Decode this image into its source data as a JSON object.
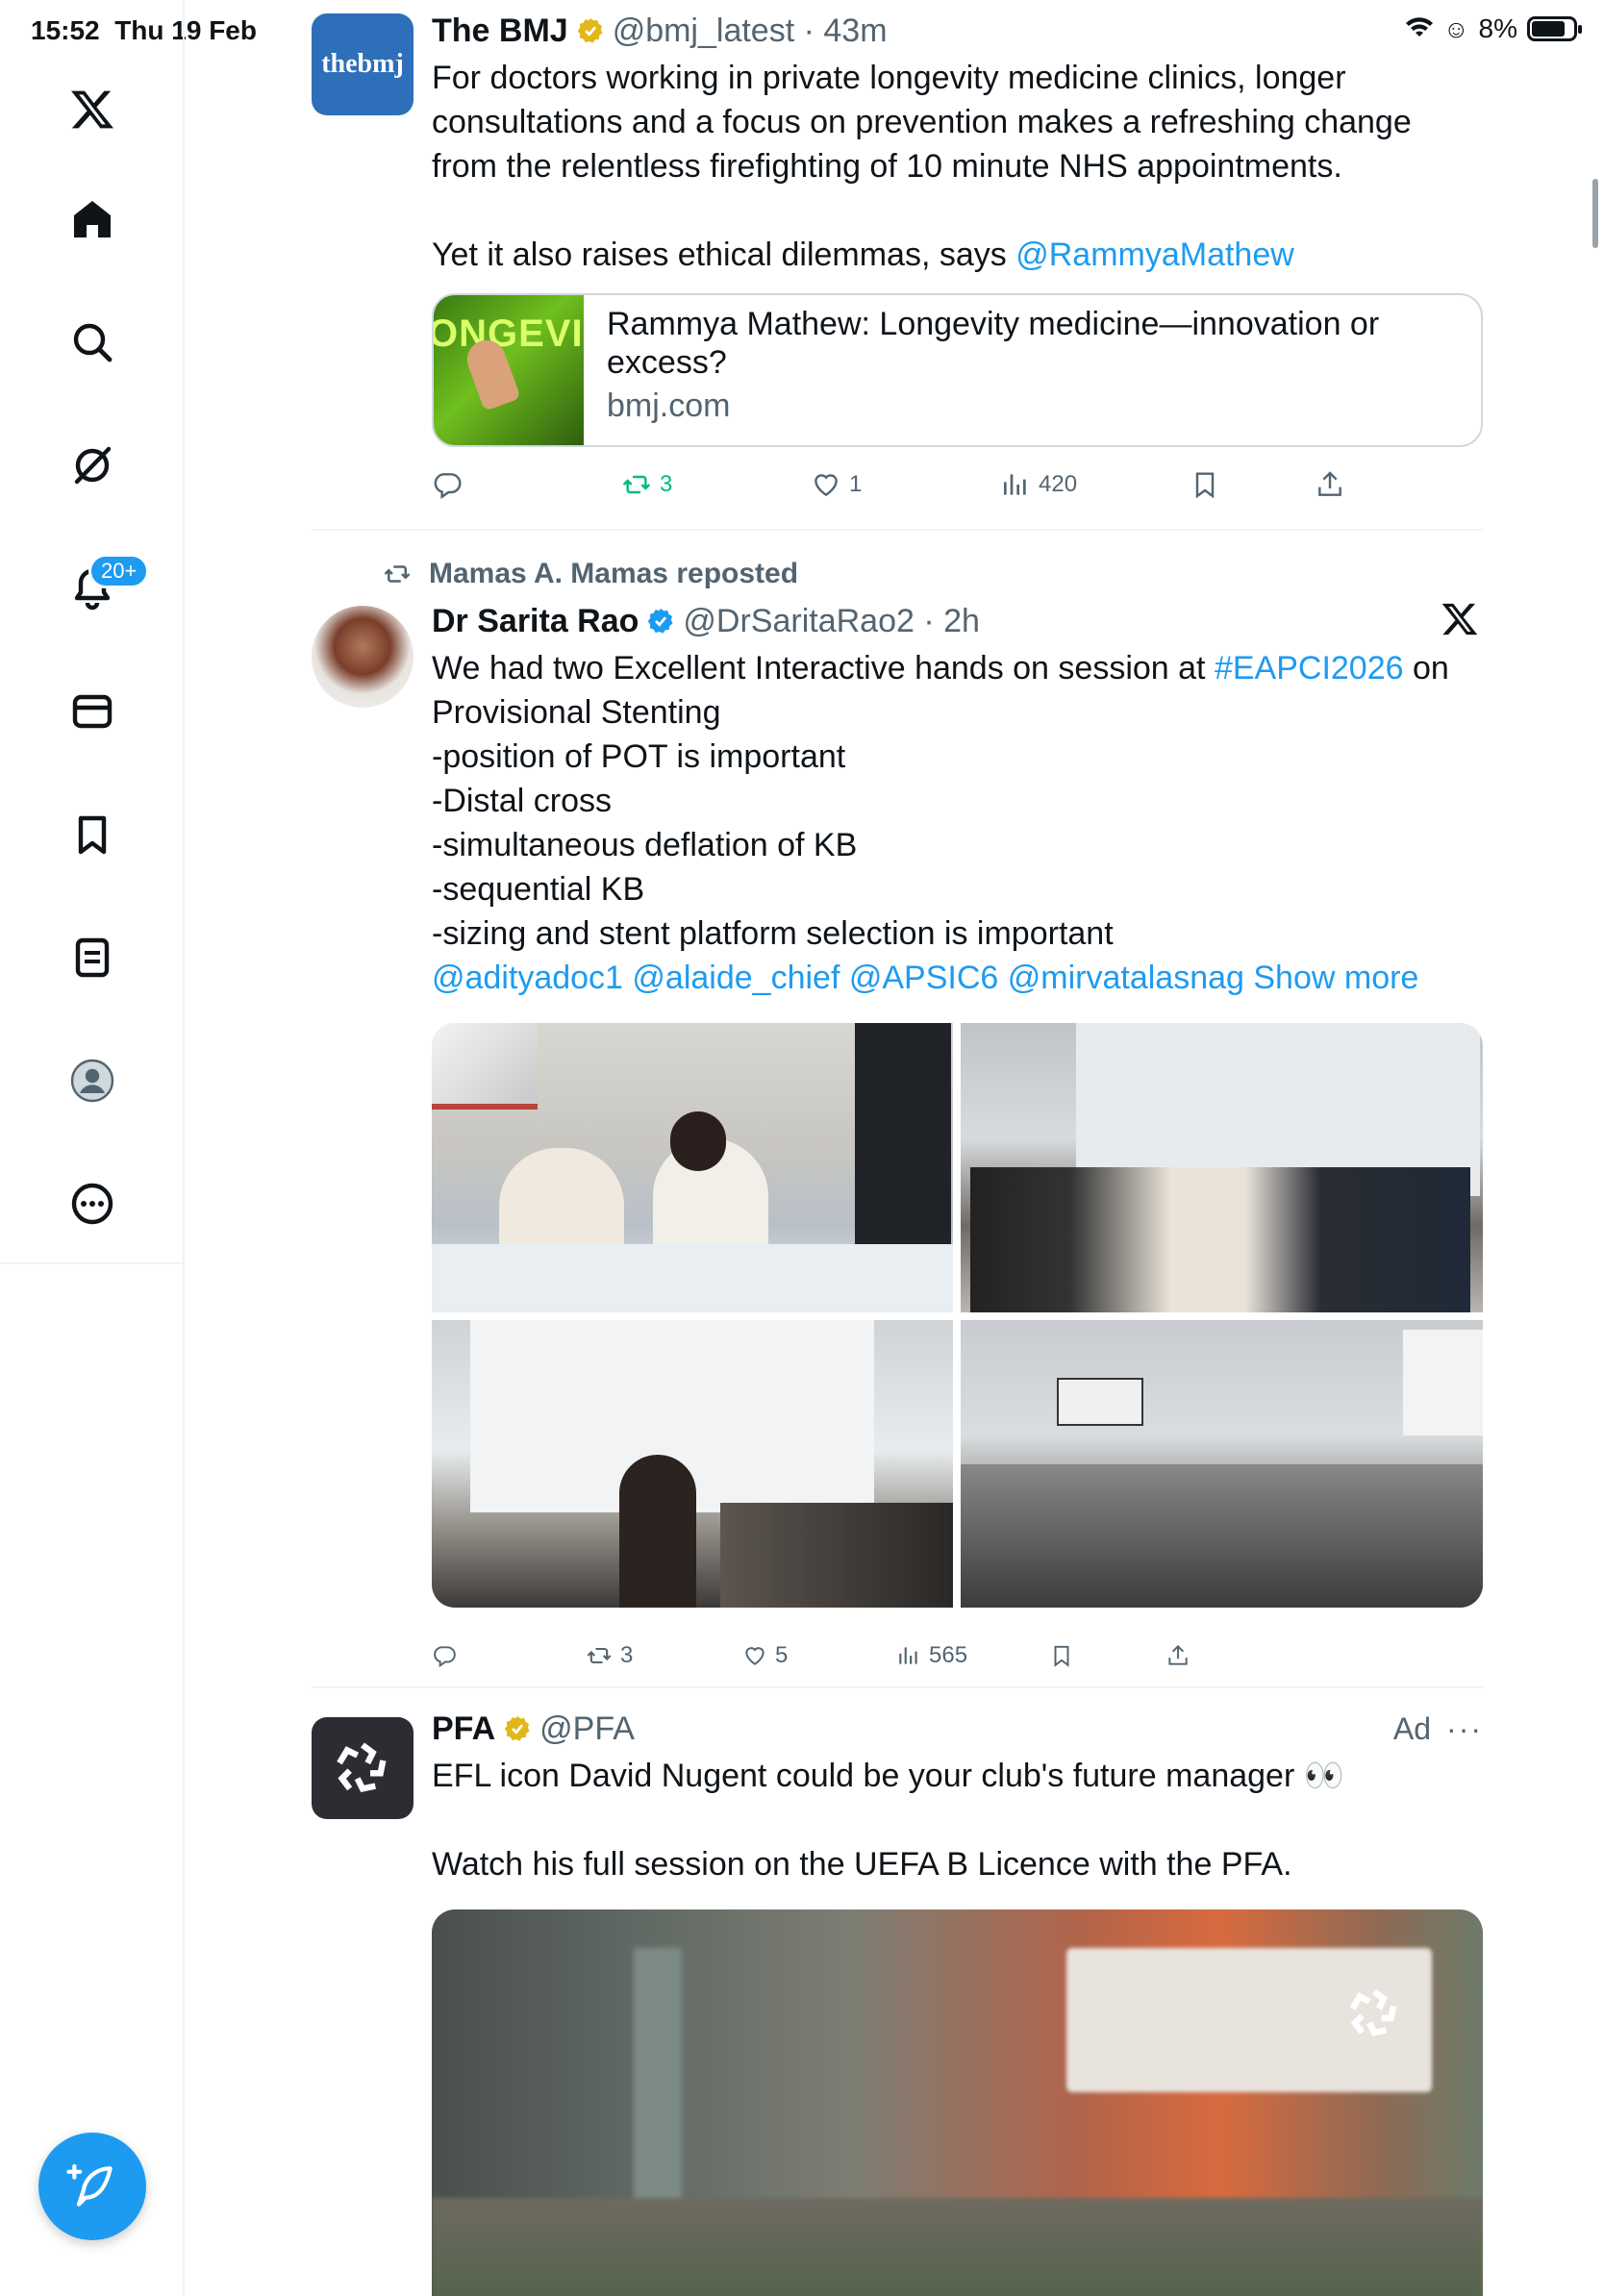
{
  "status_bar": {
    "time": "15:52",
    "date": "Thu 19 Feb",
    "battery": "8%"
  },
  "sidebar": {
    "notifications_badge": "20+",
    "items": [
      "x-logo",
      "home",
      "search",
      "grok",
      "notifications",
      "messages",
      "bookmarks",
      "lists",
      "profile",
      "more"
    ]
  },
  "tweets": [
    {
      "name": "The BMJ",
      "handle": "@bmj_latest",
      "time": "43m",
      "avatar_text": "thebmj",
      "text_lines": [
        "For doctors working in private longevity medicine clinics, longer consultations and a focus on prevention makes a refreshing change from the relentless firefighting of 10 minute NHS appointments.",
        "Yet it also raises ethical dilemmas, says "
      ],
      "mention": "@RammyaMathew",
      "card": {
        "thumb_text": "ONGEVIT",
        "title": "Rammya Mathew: Longevity medicine—innovation or excess?",
        "domain": "bmj.com"
      },
      "stats": {
        "retweets": "3",
        "likes": "1",
        "views": "420"
      }
    },
    {
      "repost_label": "Mamas A. Mamas reposted",
      "name": "Dr Sarita Rao",
      "handle": "@DrSaritaRao2",
      "time": "2h",
      "text_intro": "We had two Excellent Interactive  hands on session at ",
      "hashtag": "#EAPCI2026",
      "text_after_hashtag": " on",
      "lines": [
        "Provisional Stenting",
        "-position of POT is important",
        "-Distal cross",
        "-simultaneous deflation of KB",
        "-sequential KB",
        "-sizing and stent platform selection is important"
      ],
      "mentions": "@adityadoc1 @alaide_chief @APSIC6 @mirvatalasnag",
      "show_more": "Show more",
      "stats": {
        "retweets": "3",
        "likes": "5",
        "views": "565"
      }
    },
    {
      "name": "PFA",
      "handle": "@PFA",
      "ad_label": "Ad",
      "text_line1": "EFL icon David Nugent could be your club's future manager 👀",
      "text_line2": "Watch his full session on the UEFA B Licence with the PFA."
    }
  ],
  "colors": {
    "accent": "#1d9bf0",
    "retweet_green": "#00ba7c",
    "verified_gold": "#e2b719",
    "text": "#0f1419",
    "muted": "#536471"
  }
}
